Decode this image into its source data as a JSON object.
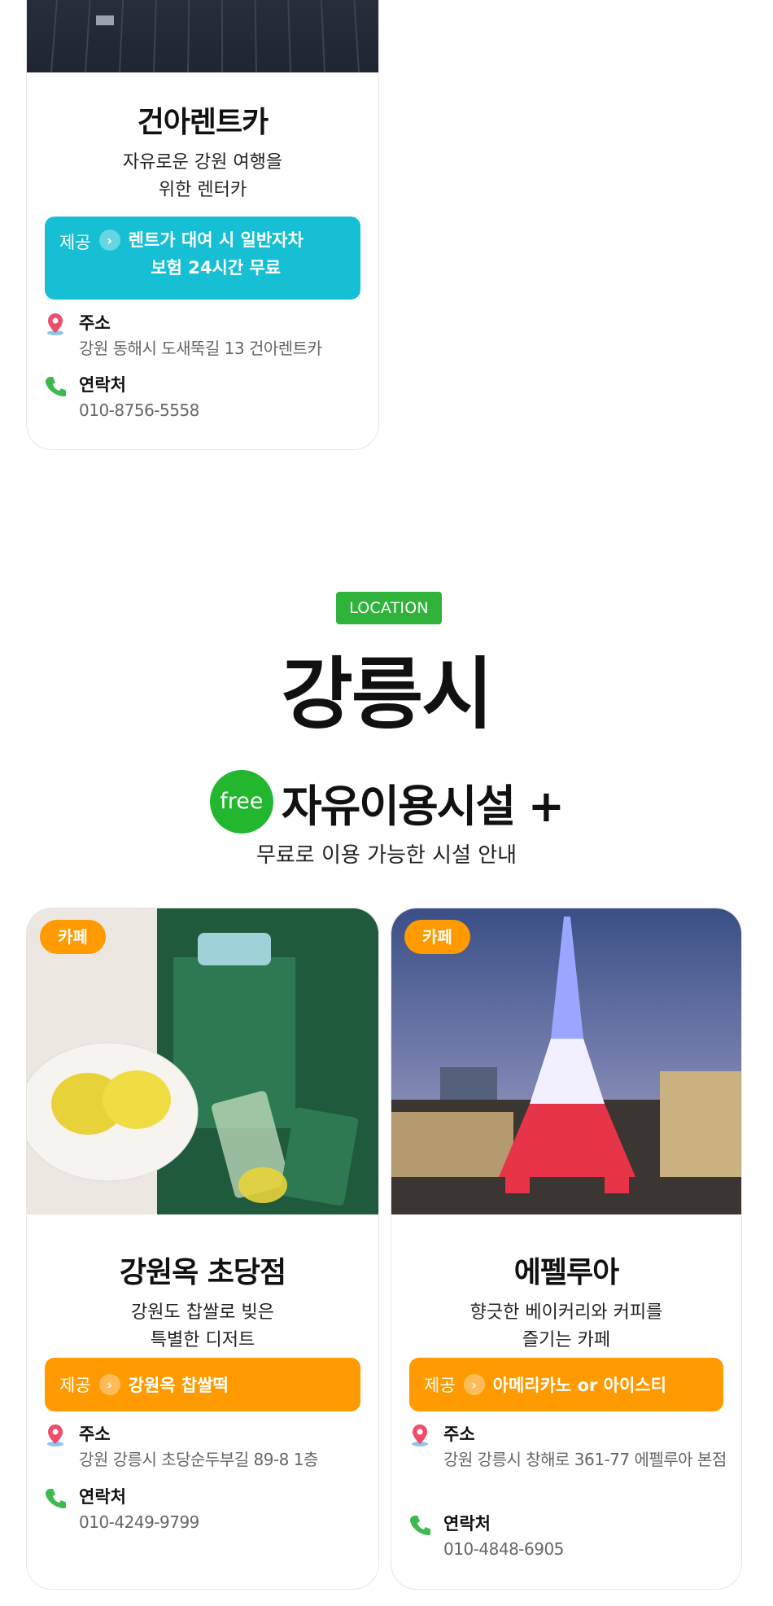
{
  "cards": {
    "rentcar": {
      "title": "건아렌트카",
      "desc1": "자유로운 강원 여행을",
      "desc2": "위한 렌터카",
      "offer_label": "제공",
      "offer_line1": "렌트가 대여 시 일반자차",
      "offer_line2": "보험 24시간 무료",
      "address_label": "주소",
      "address": "강원 동해시 도새뚝길 13 건아렌트카",
      "phone_label": "연락처",
      "phone": "010-8756-5558",
      "offer_color": "#17bfd5"
    },
    "gangwonok": {
      "badge": "카페",
      "title": "강원옥 초당점",
      "desc1": "강원도 찹쌀로 빚은",
      "desc2": "특별한 디저트",
      "offer_label": "제공",
      "offer": "강원옥 찹쌀떡",
      "address_label": "주소",
      "address": "강원 강릉시 초당순두부길 89-8 1층",
      "phone_label": "연락처",
      "phone": "010-4249-9799",
      "offer_color": "#ff9a00"
    },
    "eiffel": {
      "badge": "카페",
      "title": "에펠루아",
      "desc1": "향긋한 베이커리와 커피를",
      "desc2": "즐기는 카페",
      "offer_label": "제공",
      "offer": "아메리카노 or 아이스티",
      "address_label": "주소",
      "address": "강원 강릉시 창해로 361-77 에펠루아 본점",
      "phone_label": "연락처",
      "phone": "010-4848-6905",
      "offer_color": "#ff9a00"
    }
  },
  "section": {
    "tag": "LOCATION",
    "city": "강릉시",
    "free_badge": "free",
    "title": "자유이용시설 +",
    "subtitle": "무료로 이용 가능한 시설 안내"
  },
  "colors": {
    "accent_green": "#22b72f",
    "badge_orange": "#ff9a00",
    "offer_teal": "#17bfd5"
  },
  "icons": [
    "location-pin-icon",
    "phone-icon",
    "chevron-right-icon"
  ]
}
